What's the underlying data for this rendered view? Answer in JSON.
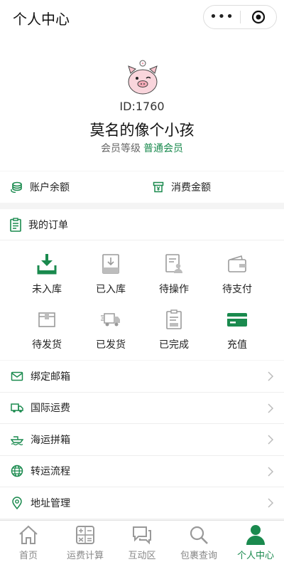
{
  "topbar": {
    "title": "个人中心",
    "more": "•••"
  },
  "profile": {
    "id_text": "ID:1760",
    "nickname": "莫名的像个小孩",
    "level_label": "会员等级",
    "level_value": "普通会员"
  },
  "balance": {
    "account_label": "账户余额",
    "spend_label": "消费金额"
  },
  "orders": {
    "title": "我的订单",
    "items": [
      {
        "label": "未入库",
        "icon": "download-box-icon"
      },
      {
        "label": "已入库",
        "icon": "inbox-tray-icon"
      },
      {
        "label": "待操作",
        "icon": "operator-doc-icon"
      },
      {
        "label": "待支付",
        "icon": "wallet-icon"
      },
      {
        "label": "待发货",
        "icon": "package-icon"
      },
      {
        "label": "已发货",
        "icon": "delivery-truck-icon"
      },
      {
        "label": "已完成",
        "icon": "clipboard-check-icon"
      },
      {
        "label": "充值",
        "icon": "credit-card-icon"
      }
    ]
  },
  "menu": [
    {
      "label": "绑定邮箱",
      "icon": "mail-icon"
    },
    {
      "label": "国际运费",
      "icon": "truck-icon"
    },
    {
      "label": "海运拼箱",
      "icon": "ship-icon"
    },
    {
      "label": "转运流程",
      "icon": "globe-icon"
    },
    {
      "label": "地址管理",
      "icon": "location-pin-icon"
    }
  ],
  "tabs": [
    {
      "label": "首页",
      "icon": "home-icon",
      "active": false
    },
    {
      "label": "运费计算",
      "icon": "calculator-icon",
      "active": false
    },
    {
      "label": "互动区",
      "icon": "chat-icon",
      "active": false
    },
    {
      "label": "包裹查询",
      "icon": "search-icon",
      "active": false
    },
    {
      "label": "个人中心",
      "icon": "person-icon",
      "active": true
    }
  ],
  "colors": {
    "accent": "#1a8a4e",
    "muted_icon": "#9a9a9a"
  }
}
